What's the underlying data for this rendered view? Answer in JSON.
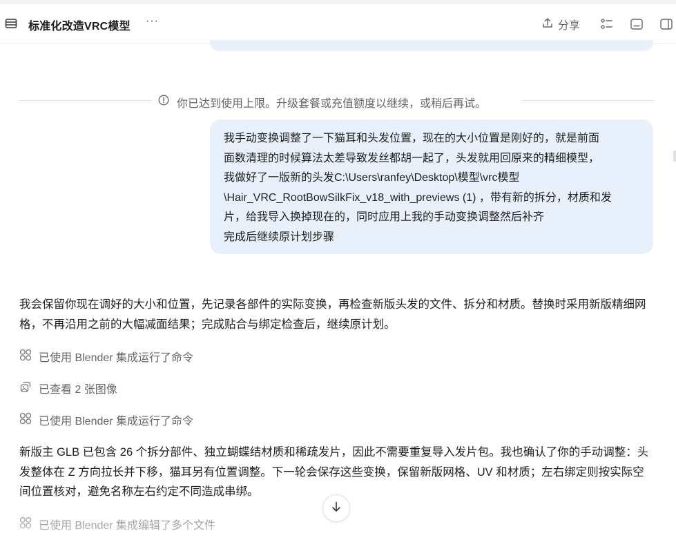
{
  "header": {
    "title": "标准化改造VRC模型",
    "more_label": "···",
    "share_label": "分享",
    "icons": [
      "folder-icon",
      "upload-icon",
      "checklist-icon",
      "panel-bottom-icon",
      "panel-right-icon"
    ]
  },
  "notice": {
    "icon": "info-circle-icon",
    "text": "你已达到使用上限。升级套餐或充值额度以继续，或稍后再试。"
  },
  "user_message": {
    "lines": [
      "我手动变换调整了一下猫耳和头发位置，现在的大小位置是刚好的，就是前面",
      "面数清理的时候算法太差导致发丝都胡一起了，头发就用回原来的精细模型，",
      "我做好了一版新的头发C:\\Users\\ranfey\\Desktop\\模型\\vrc模型",
      "\\Hair_VRC_RootBowSilkFix_v18_with_previews (1) ，带有新的拆分，材质和发",
      "片，给我导入换掉现在的，同时应用上我的手动变换调整然后补齐",
      "完成后继续原计划步骤"
    ]
  },
  "assistant": {
    "para1": "我会保留你现在调好的大小和位置，先记录各部件的实际变换，再检查新版头发的文件、拆分和材质。替换时采用新版精细网格，不再沿用之前的大幅减面结果；完成贴合与绑定检查后，继续原计划。",
    "tool1": "已使用 Blender 集成运行了命令",
    "tool2": "已查看 2 张图像",
    "tool3": "已使用 Blender 集成运行了命令",
    "para2": "新版主 GLB 已包含 26 个拆分部件、独立蝴蝶结材质和稀疏发片，因此不需要重复导入发片包。我也确认了你的手动调整：头发整体在 Z 方向拉长并下移，猫耳另有位置调整。下一轮会保存这些变换，保留新版网格、UV 和材质；左右绑定则按实际空间位置核对，避免名称左右约定不同造成串绑。",
    "tool4": "已使用 Blender 集成编辑了多个文件"
  },
  "colors": {
    "bubble": "#e8f1fb",
    "muted_text": "#666666",
    "body_text": "#1f1f1f"
  }
}
